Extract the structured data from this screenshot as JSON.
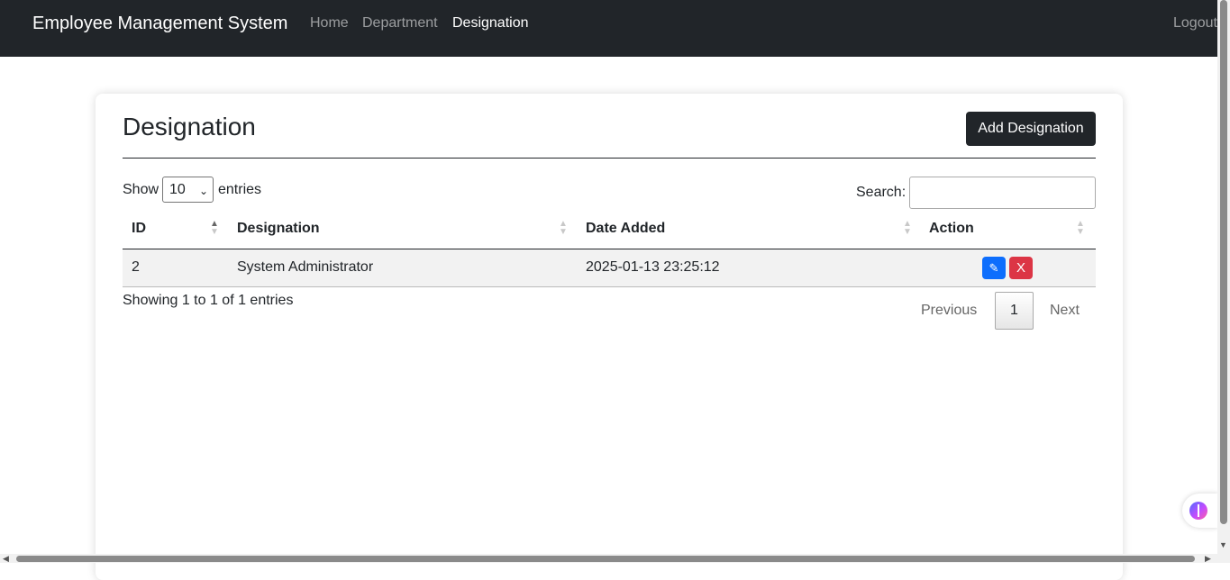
{
  "navbar": {
    "brand": "Employee Management System",
    "links": [
      {
        "label": "Home",
        "active": false
      },
      {
        "label": "Department",
        "active": false
      },
      {
        "label": "Designation",
        "active": true
      }
    ],
    "logout": "Logout",
    "bg_color": "#212529"
  },
  "page": {
    "title": "Designation",
    "add_button": "Add Designation"
  },
  "table_controls": {
    "show_label": "Show",
    "entries_label": "entries",
    "page_length": "10",
    "search_label": "Search:",
    "search_value": ""
  },
  "table": {
    "columns": [
      "ID",
      "Designation",
      "Date Added",
      "Action"
    ],
    "sorted_column": "ID",
    "rows": [
      {
        "id": "2",
        "designation": "System Administrator",
        "date_added": "2025-01-13 23:25:12"
      }
    ],
    "edit_icon": "pencil-icon",
    "delete_label": "X"
  },
  "footer": {
    "info": "Showing 1 to 1 of 1 entries",
    "previous": "Previous",
    "current_page": "1",
    "next": "Next"
  },
  "colors": {
    "edit": "#0d6efd",
    "delete": "#dc3545",
    "button_dark": "#212529"
  }
}
